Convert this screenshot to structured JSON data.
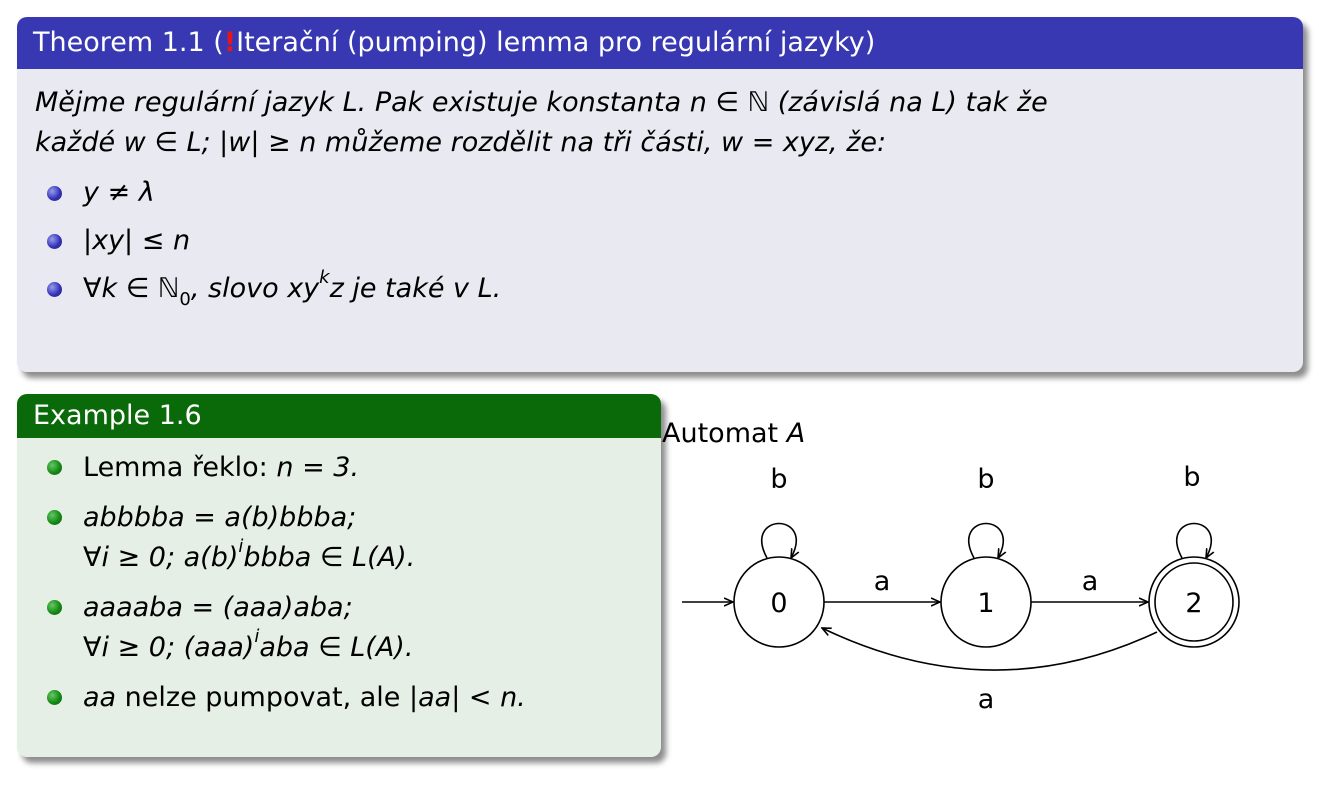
{
  "theorem": {
    "title_prefix": "Theorem 1.1 (",
    "title_mark": "!",
    "title_suffix": "Iterační (pumping) lemma pro regulární jazyky)",
    "statement_line1": "Mějme regulární jazyk L. Pak existuje konstanta n ∈ ℕ (závislá na L) tak že",
    "statement_line2": "každé w ∈ L; |w| ≥ n můžeme rozdělit na tři části, w = xyz, že:",
    "conditions": [
      "y ≠ λ",
      "|xy| ≤ n",
      {
        "prefix": "∀k ∈ ℕ",
        "sub": "0",
        "mid": ", slovo xy",
        "sup": "k",
        "suffix": "z je také v L."
      }
    ]
  },
  "example": {
    "title": "Example 1.6",
    "items": [
      {
        "text": "Lemma řeklo: ",
        "math": "n = 3."
      },
      {
        "line1": "abbbba = a(b)bbba;",
        "line2_prefix": "∀i ≥ 0; a(b)",
        "line2_sup": "i",
        "line2_suffix": "bbba ∈ L(A)."
      },
      {
        "line1": "aaaaba = (aaa)aba;",
        "line2_prefix": "∀i ≥ 0; (aaa)",
        "line2_sup": "i",
        "line2_suffix": "aba ∈ L(A)."
      },
      {
        "it": "aa",
        "text": " nelze pumpovat, ale ",
        "math": "|aa| < n."
      }
    ]
  },
  "automaton": {
    "title_text": "Automat ",
    "title_var": "A",
    "states": [
      "0",
      "1",
      "2"
    ],
    "accepting_state": "2",
    "initial_state": "0",
    "loop_labels": [
      "b",
      "b",
      "b"
    ],
    "transition_labels": [
      "a",
      "a",
      "a"
    ]
  }
}
